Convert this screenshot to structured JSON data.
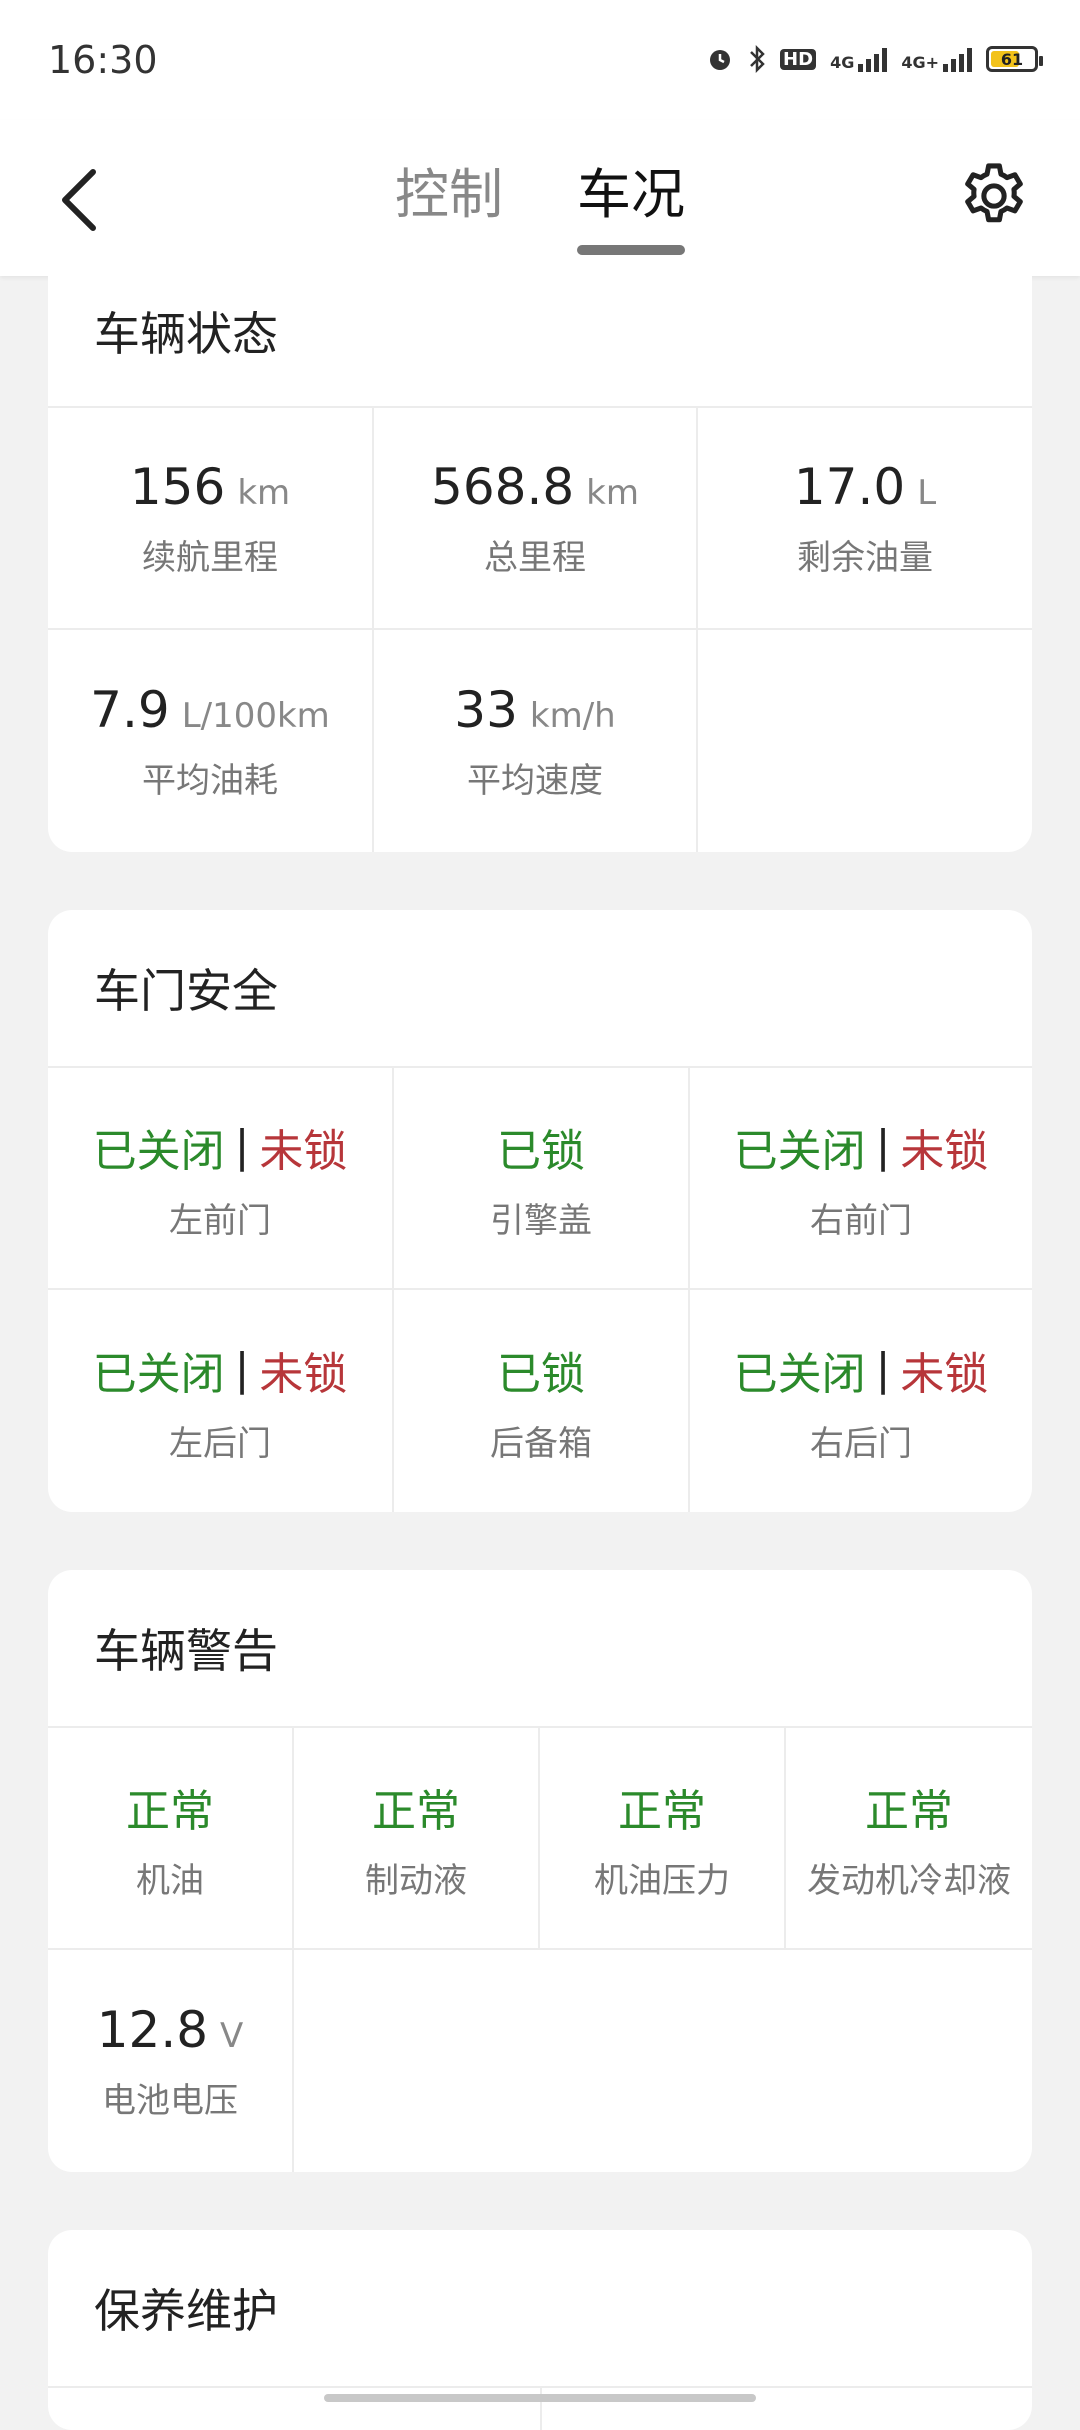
{
  "status_bar": {
    "time": "16:30",
    "icons": [
      "alarm-icon",
      "bluetooth-icon",
      "hd-icon",
      "signal-4g-icon",
      "signal-4g-plus-icon",
      "battery-icon"
    ],
    "hd_label": "HD",
    "net1": "4G",
    "net2": "4G+",
    "battery_level": "61"
  },
  "nav": {
    "tabs": [
      {
        "label": "控制"
      },
      {
        "label": "车况"
      }
    ],
    "active_tab": "车况"
  },
  "vehicle_status": {
    "title": "车辆状态",
    "items": [
      {
        "value": "156",
        "unit": "km",
        "label": "续航里程"
      },
      {
        "value": "568.8",
        "unit": "km",
        "label": "总里程"
      },
      {
        "value": "17.0",
        "unit": "L",
        "label": "剩余油量"
      },
      {
        "value": "7.9",
        "unit": "L/100km",
        "label": "平均油耗"
      },
      {
        "value": "33",
        "unit": "km/h",
        "label": "平均速度"
      }
    ]
  },
  "door_safety": {
    "title": "车门安全",
    "closed_text": "已关闭",
    "unlocked_text": "未锁",
    "locked_text": "已锁",
    "separator": "|",
    "items": [
      {
        "label": "左前门",
        "type": "door"
      },
      {
        "label": "引擎盖",
        "type": "lock"
      },
      {
        "label": "右前门",
        "type": "door"
      },
      {
        "label": "左后门",
        "type": "door"
      },
      {
        "label": "后备箱",
        "type": "lock"
      },
      {
        "label": "右后门",
        "type": "door"
      }
    ]
  },
  "vehicle_warning": {
    "title": "车辆警告",
    "normal_text": "正常",
    "items": [
      {
        "label": "机油"
      },
      {
        "label": "制动液"
      },
      {
        "label": "机油压力"
      },
      {
        "label": "发动机冷却液"
      }
    ],
    "battery": {
      "value": "12.8",
      "unit": "V",
      "label": "电池电压"
    }
  },
  "maintenance": {
    "title": "保养维护"
  },
  "colors": {
    "green": "#2b8a2b",
    "red": "#b7363a",
    "background": "#f2f2f2"
  }
}
